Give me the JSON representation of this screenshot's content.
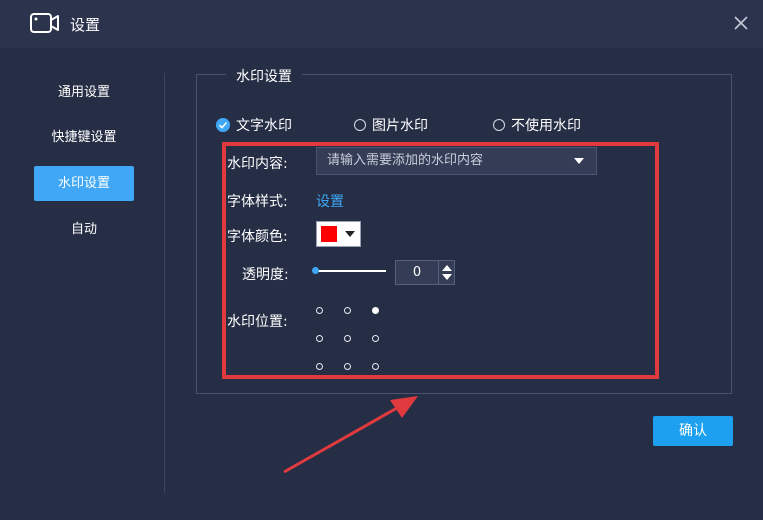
{
  "window": {
    "title": "设置",
    "app_icon": "video-camera-icon",
    "close_icon": "close-icon"
  },
  "sidebar": {
    "items": [
      {
        "label": "通用设置",
        "active": false
      },
      {
        "label": "快捷键设置",
        "active": false
      },
      {
        "label": "水印设置",
        "active": true
      },
      {
        "label": "自动",
        "active": false
      }
    ]
  },
  "watermark": {
    "group_title": "水印设置",
    "mode_options": [
      {
        "label": "文字水印",
        "checked": true
      },
      {
        "label": "图片水印",
        "checked": false
      },
      {
        "label": "不使用水印",
        "checked": false
      }
    ],
    "content_label": "水印内容:",
    "content_placeholder": "请输入需要添加的水印内容",
    "font_style_label": "字体样式:",
    "font_style_link": "设置",
    "font_color_label": "字体颜色:",
    "font_color_value": "#ff0000",
    "opacity_label": "透明度:",
    "opacity_value": "0",
    "position_label": "水印位置:",
    "position_grid": {
      "rows": 3,
      "cols": 3,
      "selected_row": 0,
      "selected_col": 2
    }
  },
  "footer": {
    "confirm_label": "确认"
  },
  "colors": {
    "accent": "#3fa7f5",
    "background": "#262e45",
    "titlebar": "#2b334d",
    "annotation": "#e03a3e"
  }
}
